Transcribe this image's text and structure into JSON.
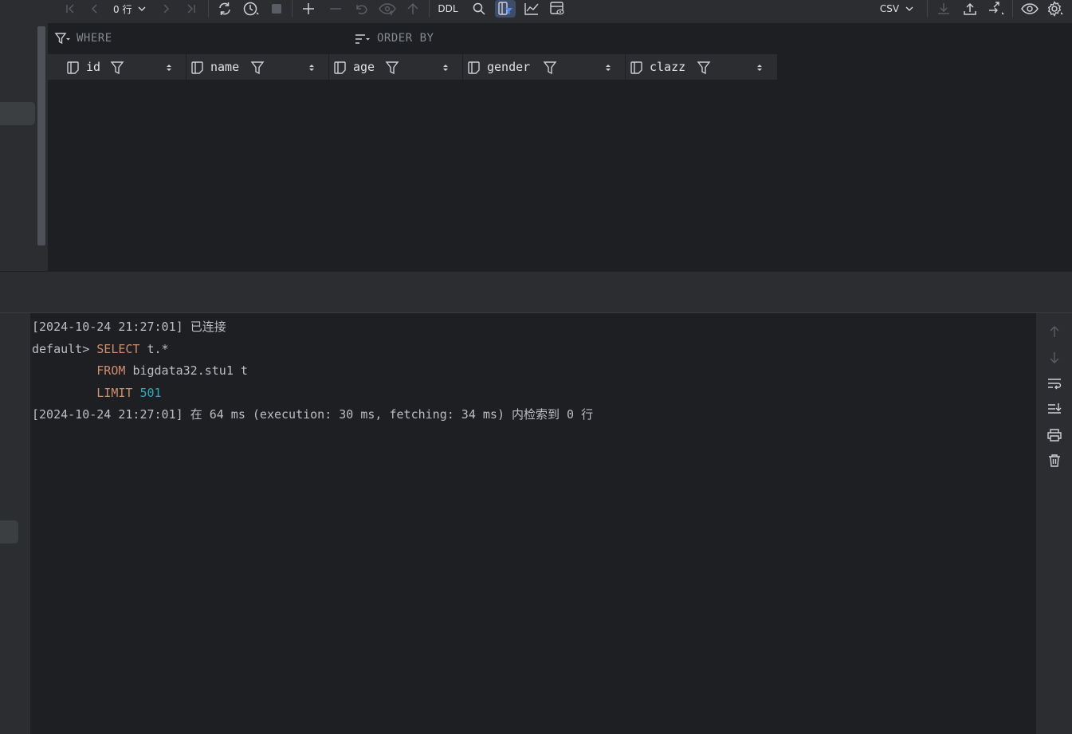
{
  "toolbar": {
    "row_count": "0 行",
    "ddl_label": "DDL",
    "export_format": "CSV"
  },
  "filter_bar": {
    "where_label": "WHERE",
    "order_by_label": "ORDER BY"
  },
  "columns": [
    {
      "name": "id"
    },
    {
      "name": "name"
    },
    {
      "name": "age"
    },
    {
      "name": "gender"
    },
    {
      "name": "clazz"
    }
  ],
  "console": {
    "line1": {
      "timestamp": "[2024-10-24 21:27:01]",
      "text": "已连接"
    },
    "line2": {
      "prompt": "default>",
      "keyword": "SELECT",
      "rest": "t.*"
    },
    "line3": {
      "keyword": "FROM",
      "rest": "bigdata32.stu1 t"
    },
    "line4": {
      "keyword": "LIMIT",
      "number": "501"
    },
    "line5": {
      "timestamp": "[2024-10-24 21:27:01]",
      "text": "在 64 ms (execution: 30 ms, fetching: 34 ms) 内检索到 0 行"
    }
  },
  "colors": {
    "background": "#1e1f22",
    "panel": "#2b2d30",
    "keyword": "#cf8e6d",
    "number": "#2aacb8",
    "accent": "#548af7"
  }
}
